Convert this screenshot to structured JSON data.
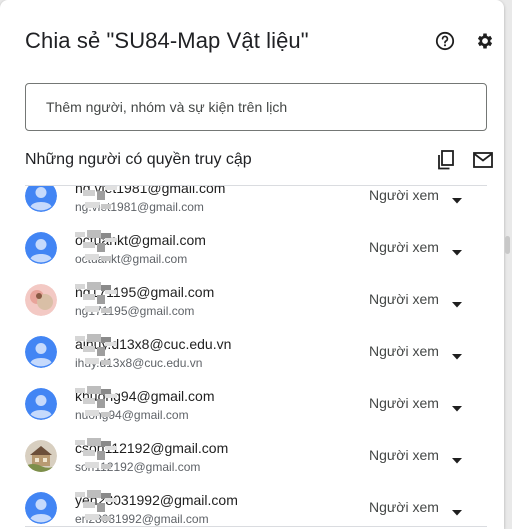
{
  "dialog": {
    "title": "Chia sẻ \"SU84-Map Vật liệu\"",
    "help_icon": "help-circle-icon",
    "settings_icon": "gear-icon"
  },
  "add_people": {
    "placeholder": "Thêm người, nhóm và sự kiện trên lịch"
  },
  "access_section": {
    "title": "Những người có quyền truy cập",
    "copy_icon": "copy-icon",
    "email_icon": "mail-icon"
  },
  "people": [
    {
      "name": "ng.viet1981@gmail.com",
      "email": "ng.viet1981@gmail.com",
      "avatar": "default",
      "role": "Người xem"
    },
    {
      "name": "octuankt@gmail.com",
      "email": "octuankt@gmail.com",
      "avatar": "default",
      "role": "Người xem"
    },
    {
      "name": "ng171195@gmail.com",
      "email": "ng171195@gmail.com",
      "avatar": "photo-pink",
      "role": "Người xem"
    },
    {
      "name": "aihuy.d13x8@cuc.edu.vn",
      "email": "ihuy.d13x8@cuc.edu.vn",
      "avatar": "default",
      "role": "Người xem"
    },
    {
      "name": "khuong94@gmail.com",
      "email": "nuong94@gmail.com",
      "avatar": "default",
      "role": "Người xem"
    },
    {
      "name": "cson112192@gmail.com",
      "email": "son112192@gmail.com",
      "avatar": "photo-house",
      "role": "Người xem"
    },
    {
      "name": "yen28031992@gmail.com",
      "email": "en28031992@gmail.com",
      "avatar": "default",
      "role": "Người xem"
    }
  ],
  "colors": {
    "avatar_default": "#4285f4",
    "text_primary": "#1f1f1f",
    "text_secondary": "#5f6368"
  }
}
